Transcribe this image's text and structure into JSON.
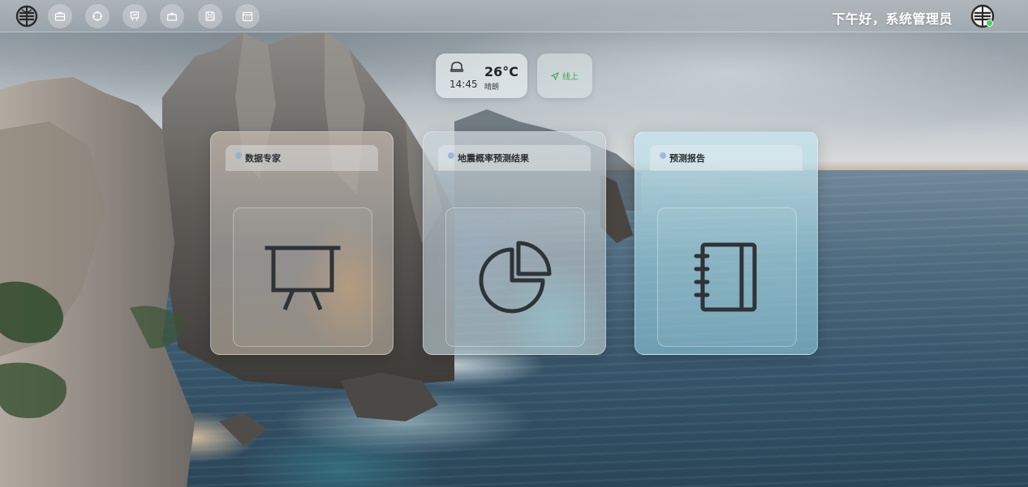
{
  "header": {
    "greeting": "下午好，系统管理员",
    "nav_icons": [
      "briefcase-icon",
      "crosshair-icon",
      "presentation-icon",
      "toolbox-icon",
      "save-icon",
      "calendar-icon"
    ]
  },
  "widgets": {
    "weather": {
      "time": "14:45",
      "temperature": "26°C",
      "condition": "晴朗",
      "icon": "bell-icon"
    },
    "status": {
      "label": "线上",
      "icon": "navigation-icon",
      "color": "#3aa84a"
    }
  },
  "cards": [
    {
      "title": "数据专家",
      "icon": "presentation-board-icon"
    },
    {
      "title": "地震概率预测结果",
      "icon": "pie-chart-icon"
    },
    {
      "title": "预测报告",
      "icon": "notebook-icon"
    }
  ],
  "colors": {
    "online": "#3fd25a",
    "icon_stroke": "#2e3338"
  }
}
